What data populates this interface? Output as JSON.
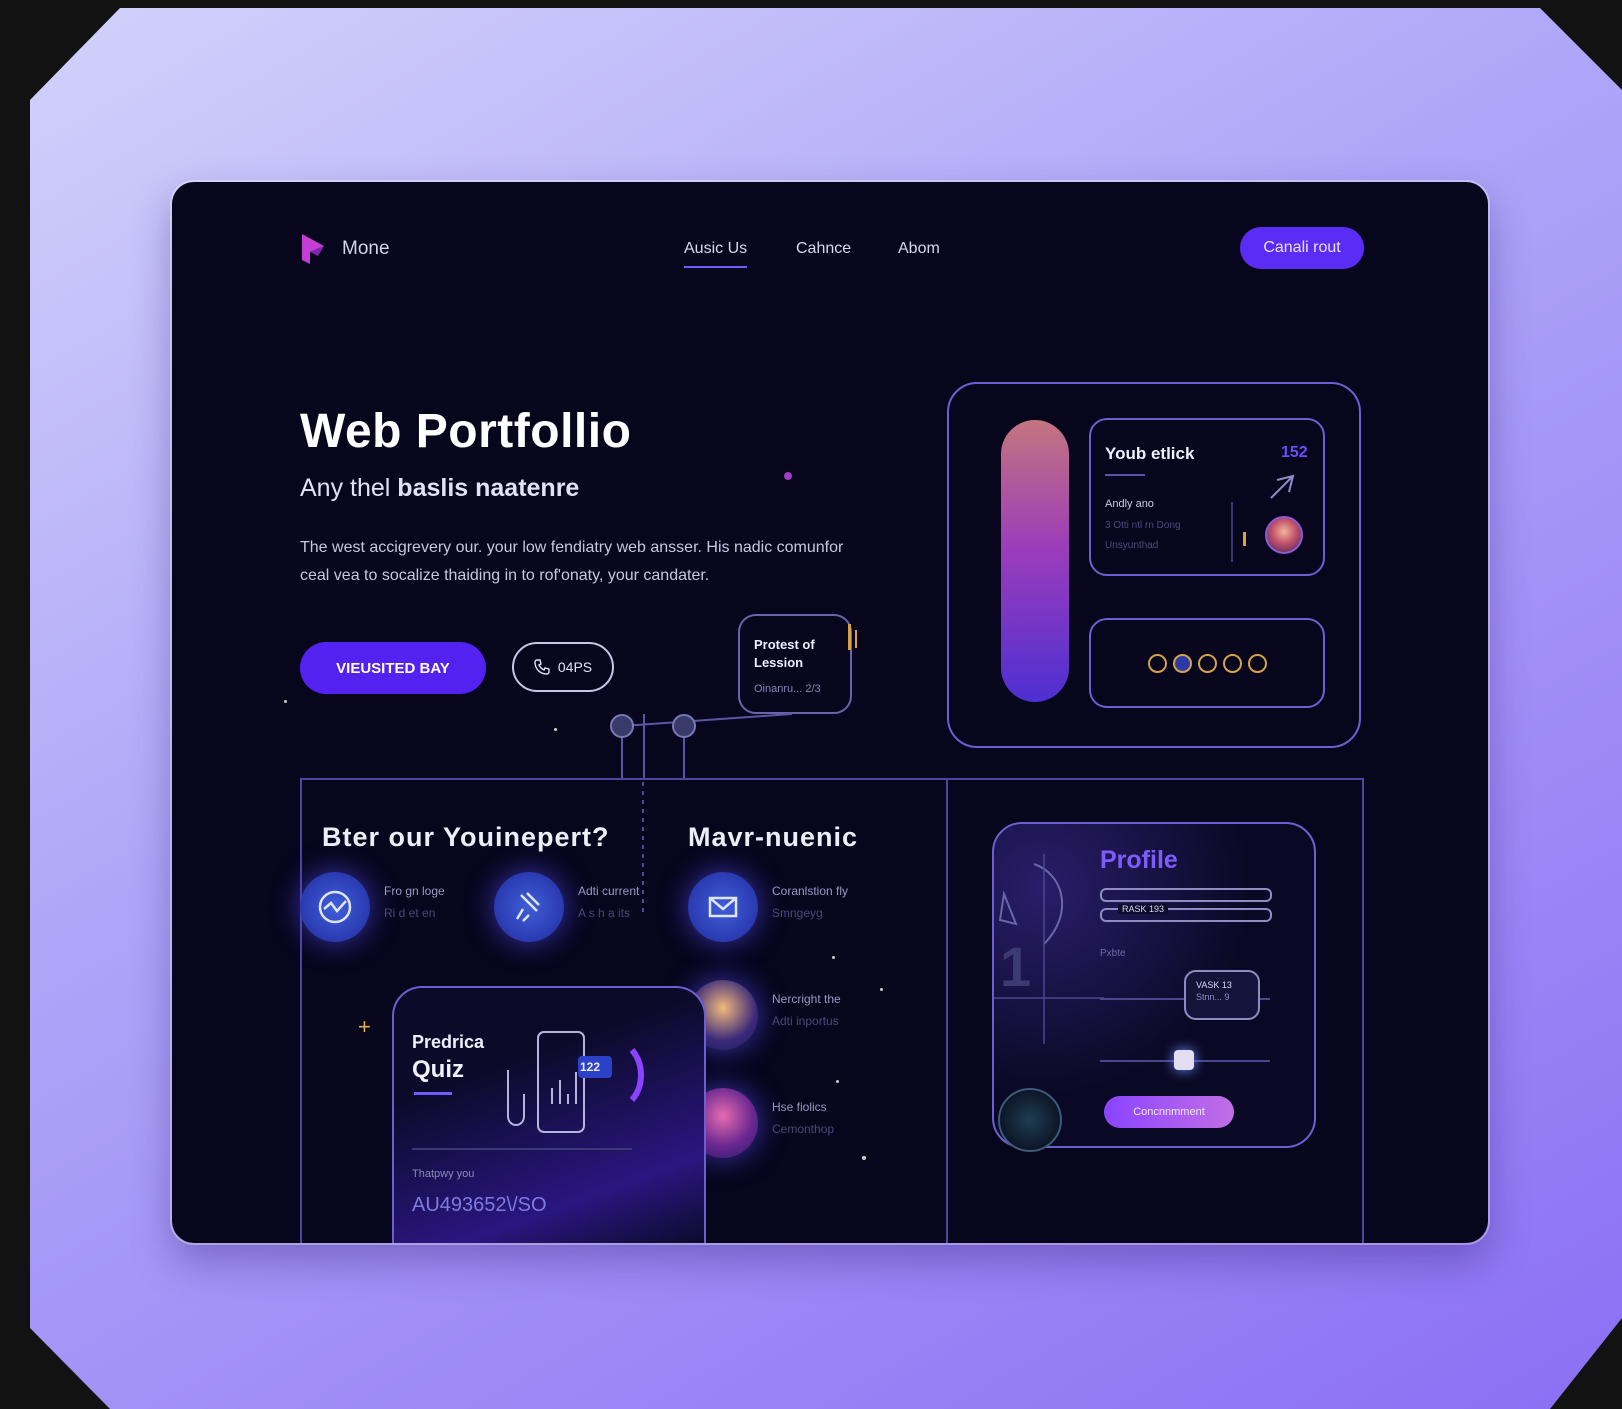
{
  "nav": {
    "brand": "Mone",
    "links": [
      "Ausic Us",
      "Cahnce",
      "Abom"
    ],
    "cta": "Canali rout"
  },
  "hero": {
    "title": "Web Portfollio",
    "subtitle_prefix": "Any thel",
    "subtitle_bold": "baslis naatenre",
    "paragraph": "The west accigrevery our. your low fendiatry web ansser. His nadic comunfor ceal vea to socalize thaiding in to rof'onaty, your candater.",
    "primary_button": "VIEUSITED BAY",
    "secondary_button": "04PS",
    "mini_card_title": "Protest of Lession",
    "mini_card_sub": "Oinanru... 2/3"
  },
  "right_panel": {
    "card_title": "Youb etlick",
    "card_badge": "152",
    "card_line1": "Andly ano",
    "card_line2": "3 Otti ntl rn Dong",
    "card_line3": "Unsyunthad"
  },
  "features": {
    "left_title": "Bter our Youinepert?",
    "right_title": "Mavr-nuenic",
    "items": [
      {
        "title": "Fro gn loge",
        "sub": "Ri d et en"
      },
      {
        "title": "Adti current",
        "sub": "A s h a its"
      },
      {
        "title": "Coranlstion fly",
        "sub": "Smngeyg"
      },
      {
        "title": "Nercright the",
        "sub": "Adti inportus"
      },
      {
        "title": "Hse fiolics",
        "sub": "Cemonthop"
      }
    ]
  },
  "quiz": {
    "title_line1": "Predrica",
    "title_line2": "Quiz",
    "badge": "122",
    "label": "Thatpwy you",
    "code": "AU493652\\/SO"
  },
  "profile": {
    "title": "Profile",
    "field": "RASK 193",
    "label": "Pxbte",
    "mini": "VASK 13",
    "mini2": "Stnn... 9",
    "big_digit": "1",
    "button": "Concnnmment"
  },
  "colors": {
    "accent": "#5b2cf6",
    "bg": "#07061d",
    "outline": "#6d5fd1"
  }
}
